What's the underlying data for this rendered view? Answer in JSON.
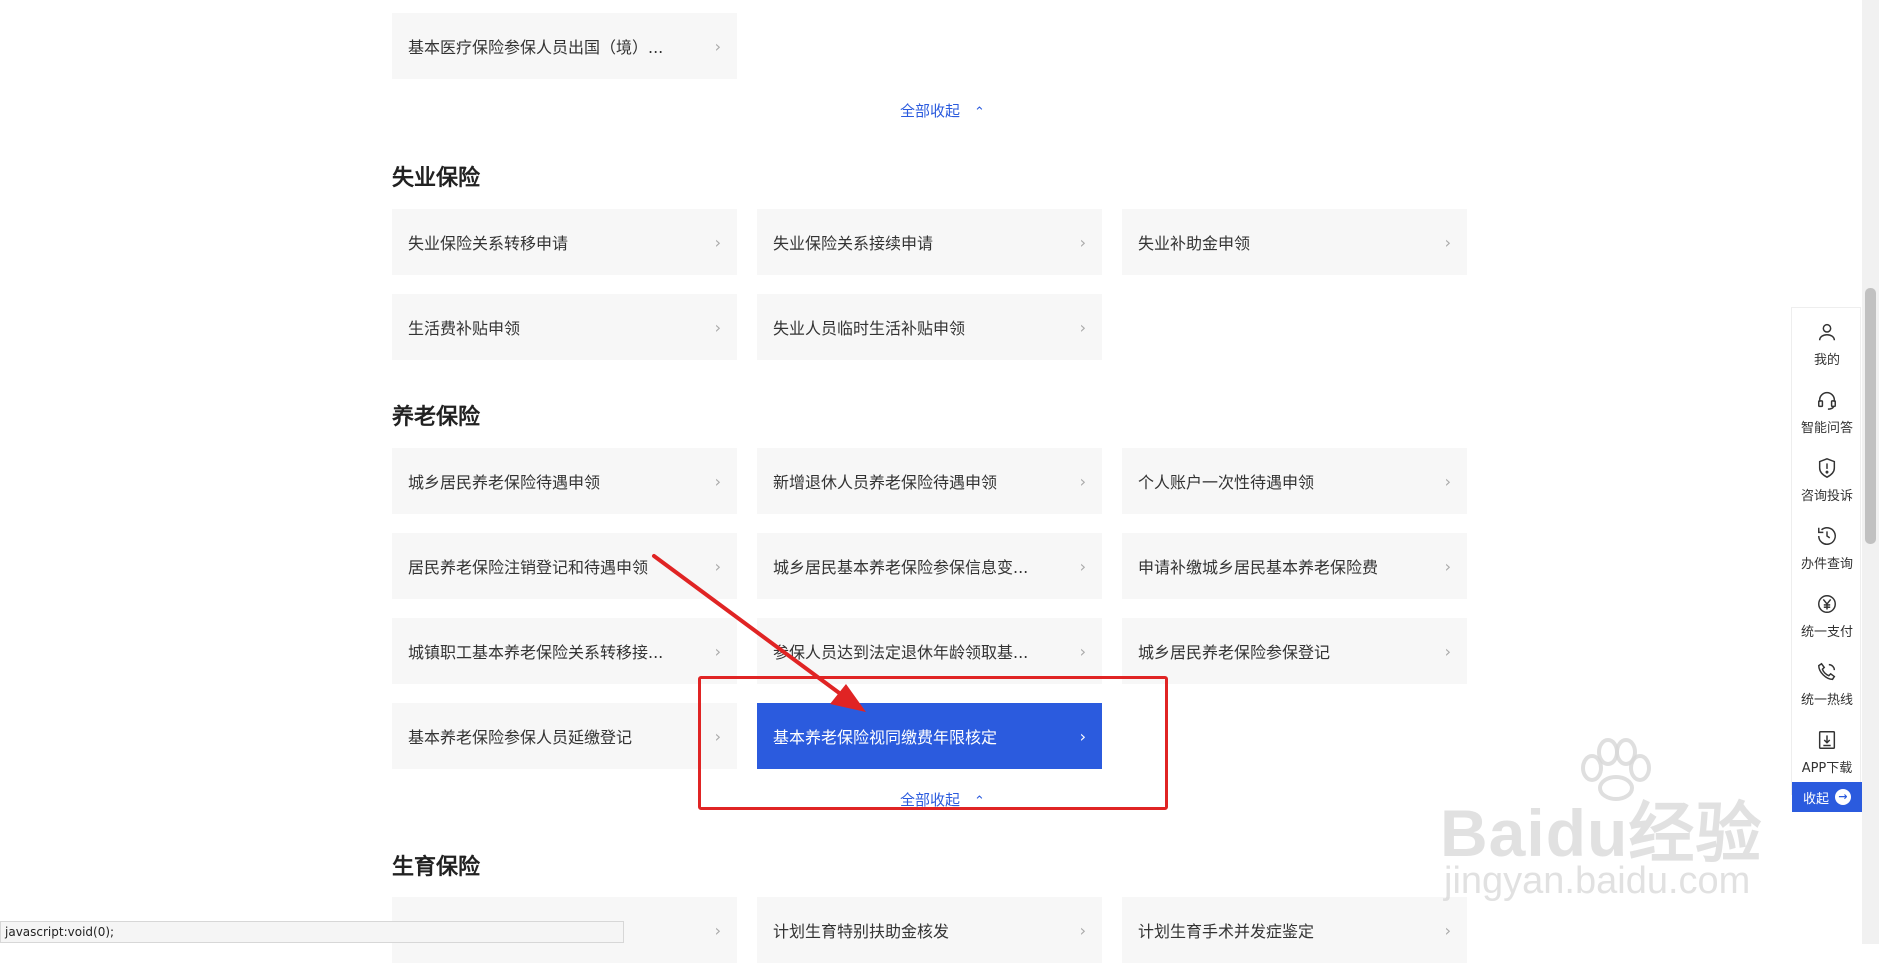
{
  "top_card": {
    "label": "基本医疗保险参保人员出国（境）...",
    "chevron": ">"
  },
  "collapse_1": {
    "label": "全部收起",
    "caret": "^"
  },
  "unemployment": {
    "title": "失业保险",
    "items": [
      {
        "label": "失业保险关系转移申请"
      },
      {
        "label": "失业保险关系接续申请"
      },
      {
        "label": "失业补助金申领"
      },
      {
        "label": "生活费补贴申领"
      },
      {
        "label": "失业人员临时生活补贴申领"
      }
    ]
  },
  "pension": {
    "title": "养老保险",
    "items": [
      {
        "label": "城乡居民养老保险待遇申领"
      },
      {
        "label": "新增退休人员养老保险待遇申领"
      },
      {
        "label": "个人账户一次性待遇申领"
      },
      {
        "label": "居民养老保险注销登记和待遇申领"
      },
      {
        "label": "城乡居民基本养老保险参保信息变..."
      },
      {
        "label": "申请补缴城乡居民基本养老保险费"
      },
      {
        "label": "城镇职工基本养老保险关系转移接..."
      },
      {
        "label": "参保人员达到法定退休年龄领取基..."
      },
      {
        "label": "城乡居民养老保险参保登记"
      },
      {
        "label": "基本养老保险参保人员延缴登记"
      },
      {
        "label": "基本养老保险视同缴费年限核定",
        "active": true
      }
    ],
    "collapse_label": "全部收起"
  },
  "maternity": {
    "title": "生育保险",
    "items": [
      {
        "label": ""
      },
      {
        "label": "计划生育特别扶助金核发"
      },
      {
        "label": "计划生育手术并发症鉴定"
      }
    ]
  },
  "sidebar": {
    "items": [
      {
        "label": "我的",
        "icon": "user-icon"
      },
      {
        "label": "智能问答",
        "icon": "headset-icon"
      },
      {
        "label": "咨询投诉",
        "icon": "shield-alert-icon"
      },
      {
        "label": "办件查询",
        "icon": "history-icon"
      },
      {
        "label": "统一支付",
        "icon": "yen-icon"
      },
      {
        "label": "统一热线",
        "icon": "phone-icon"
      },
      {
        "label": "APP下载",
        "icon": "download-icon"
      }
    ],
    "collapse_label": "收起"
  },
  "status_bar": {
    "text": "javascript:void(0);"
  },
  "watermark": {
    "brand": "Baidu经验",
    "url": "jingyan.baidu.com"
  },
  "colors": {
    "accent": "#2b5bde",
    "card_bg": "#f7f7f7",
    "annotation_red": "#e02424"
  }
}
